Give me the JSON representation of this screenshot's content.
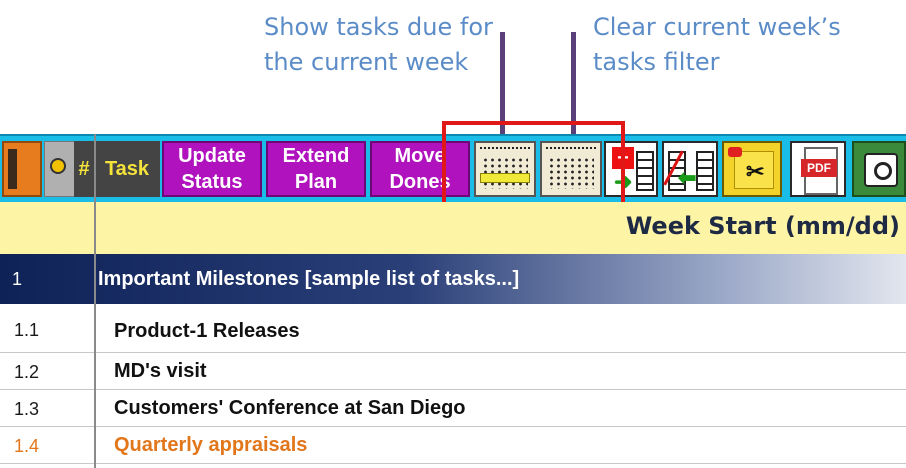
{
  "callouts": {
    "show_week": "Show tasks due for\nthe current week",
    "clear_week": "Clear current week’s\ntasks filter"
  },
  "toolbar": {
    "hash": "#",
    "task": "Task",
    "update_status": "Update\nStatus",
    "extend_plan": "Extend\nPlan",
    "move_dones": "Move\nDones",
    "pdf": "PDF"
  },
  "sheet": {
    "week_start": "Week Start (mm/dd)",
    "milestone_num": "1",
    "milestone_title": "Important Milestones [sample list of tasks...]",
    "rows": [
      {
        "num": "1.1",
        "name": "Product-1 Releases",
        "highlight": false
      },
      {
        "num": "1.2",
        "name": "MD's visit",
        "highlight": false
      },
      {
        "num": "1.3",
        "name": "Customers' Conference at San Diego",
        "highlight": false
      },
      {
        "num": "1.4",
        "name": "Quarterly appraisals",
        "highlight": true
      }
    ]
  },
  "colors": {
    "accent_purple": "#b012be",
    "toolbar_blue": "#19bde8",
    "callout_blue": "#5b8cc7",
    "highlight_red": "#e11818",
    "overdue_orange": "#e2761b"
  }
}
